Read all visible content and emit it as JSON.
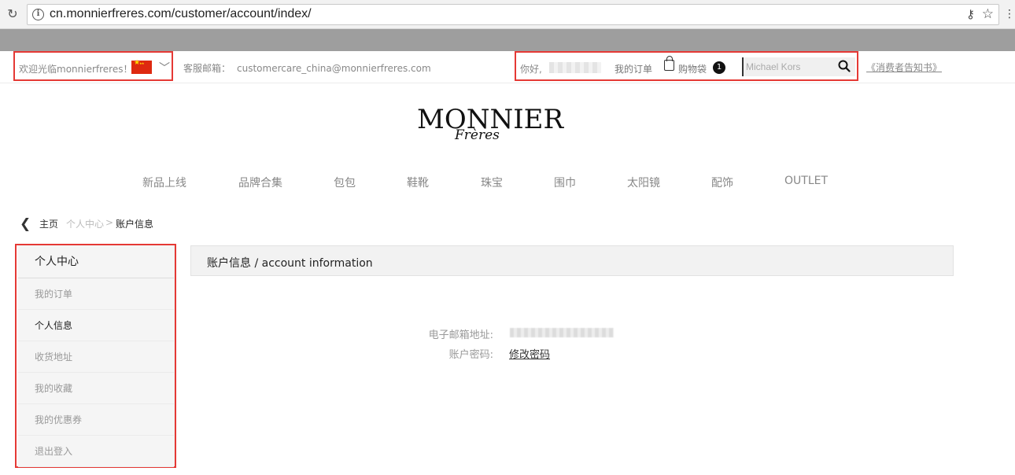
{
  "browser": {
    "url": "cn.monnierfreres.com/customer/account/index/"
  },
  "topbar": {
    "welcome": "欢迎光临monnierfreres！",
    "service_label": "客服邮箱：",
    "service_email": "customercare_china@monnierfreres.com",
    "hello": "你好,",
    "my_orders": "我的订单",
    "bag_label": "购物袋",
    "bag_count": "1",
    "search_placeholder": "Michael Kors",
    "consumer_notice": "《消费者告知书》"
  },
  "logo": {
    "main": "MONNIER",
    "sub": "Frères"
  },
  "nav": {
    "items": [
      "新品上线",
      "品牌合集",
      "包包",
      "鞋靴",
      "珠宝",
      "围巾",
      "太阳镜",
      "配饰",
      "OUTLET"
    ]
  },
  "breadcrumb": {
    "home": "主页",
    "center": "个人中心",
    "separator": ">",
    "current": "账户信息"
  },
  "sidebar": {
    "title": "个人中心",
    "items": [
      {
        "label": "我的订单",
        "active": false
      },
      {
        "label": "个人信息",
        "active": true
      },
      {
        "label": "收货地址",
        "active": false
      },
      {
        "label": "我的收藏",
        "active": false
      },
      {
        "label": "我的优惠券",
        "active": false
      },
      {
        "label": "退出登入",
        "active": false
      }
    ]
  },
  "account": {
    "title": "账户信息 / account information",
    "email_label": "电子邮箱地址:",
    "password_label": "账户密码:",
    "change_password": "修改密码"
  },
  "colors": {
    "highlight_border": "#e53935",
    "flag_red": "#de2910"
  }
}
